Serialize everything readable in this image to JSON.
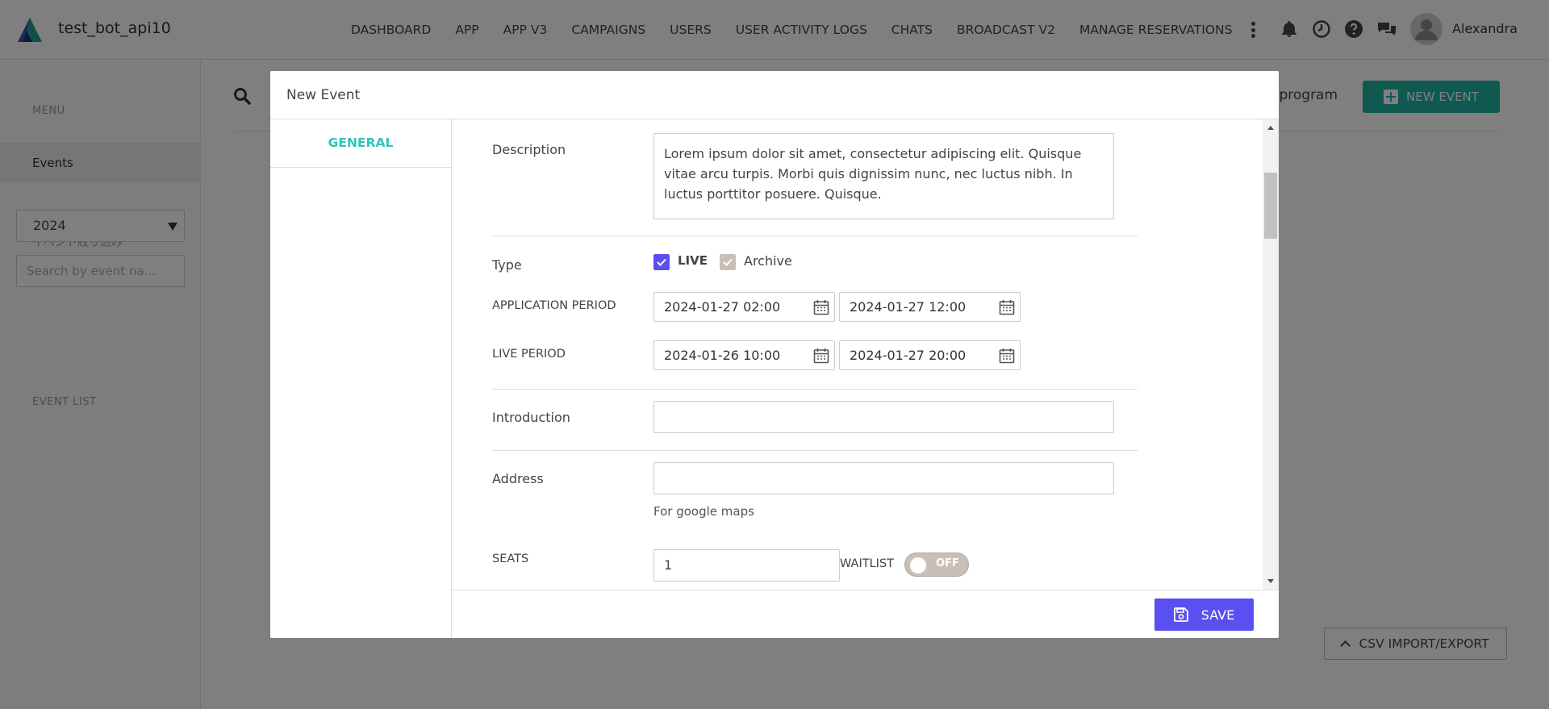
{
  "app": {
    "name": "test_bot_api10"
  },
  "nav": {
    "items": [
      {
        "label": "DASHBOARD"
      },
      {
        "label": "APP"
      },
      {
        "label": "APP V3"
      },
      {
        "label": "CAMPAIGNS"
      },
      {
        "label": "USERS"
      },
      {
        "label": "USER ACTIVITY LOGS"
      },
      {
        "label": "CHATS"
      },
      {
        "label": "BROADCAST V2"
      },
      {
        "label": "MANAGE RESERVATIONS"
      }
    ],
    "icons": [
      "more-vertical-icon",
      "bell-icon",
      "clock-icon",
      "help-icon",
      "chat-icon"
    ]
  },
  "user": {
    "name": "Alexandra"
  },
  "sidebar": {
    "menu_label": "MENU",
    "active_item": "Events",
    "filter_label": "イベント絞り込み",
    "year_select": "2024",
    "search_placeholder": "Search by event na...",
    "event_list_label": "EVENT LIST"
  },
  "main": {
    "partial_link": "y program",
    "new_event_label": "NEW EVENT",
    "csv_label": "CSV IMPORT/EXPORT"
  },
  "modal": {
    "title": "New Event",
    "tab_general": "GENERAL",
    "description_label": "Description",
    "description_value": "Lorem ipsum dolor sit amet, consectetur adipiscing elit. Quisque vitae arcu turpis. Morbi quis dignissim nunc, nec luctus nibh. In luctus porttitor posuere. Quisque.",
    "type_label": "Type",
    "type_live": "LIVE",
    "type_archive": "Archive",
    "type_live_checked": true,
    "type_archive_checked": true,
    "application_period_label": "APPLICATION PERIOD",
    "application_start": "2024-01-27 02:00",
    "application_end": "2024-01-27 12:00",
    "live_period_label": "LIVE PERIOD",
    "live_start": "2024-01-26 10:00",
    "live_end": "2024-01-27 20:00",
    "introduction_label": "Introduction",
    "introduction_value": "",
    "address_label": "Address",
    "address_value": "",
    "address_hint": "For google maps",
    "seats_label": "SEATS",
    "seats_value": "1",
    "waitlist_label": "WAITLIST",
    "waitlist_toggle": "OFF",
    "save_label": "SAVE"
  },
  "colors": {
    "accent_teal": "#1fb3a3",
    "tab_teal": "#2ec4b6",
    "primary_purple": "#5a4ff0"
  }
}
